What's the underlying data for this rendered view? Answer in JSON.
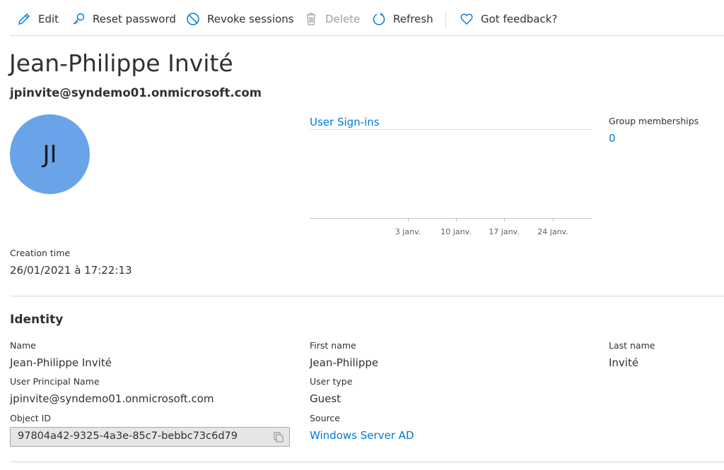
{
  "toolbar": {
    "edit": "Edit",
    "reset_password": "Reset password",
    "revoke_sessions": "Revoke sessions",
    "delete": "Delete",
    "refresh": "Refresh",
    "feedback": "Got feedback?"
  },
  "user": {
    "display_name": "Jean-Philippe Invité",
    "email": "jpinvite@syndemo01.onmicrosoft.com",
    "initials": "JI",
    "avatar_color": "#6aa4e8"
  },
  "creation": {
    "label": "Creation time",
    "value": "26/01/2021 à 17:22:13"
  },
  "chart_data": {
    "type": "line",
    "title": "User Sign-ins",
    "x_ticks": [
      "3 janv.",
      "10 janv.",
      "17 janv.",
      "24 janv."
    ],
    "series": []
  },
  "groups": {
    "label": "Group memberships",
    "value": "0"
  },
  "identity": {
    "heading": "Identity",
    "name_label": "Name",
    "name": "Jean-Philippe Invité",
    "first_name_label": "First name",
    "first_name": "Jean-Philippe",
    "last_name_label": "Last name",
    "last_name": "Invité",
    "upn_label": "User Principal Name",
    "upn": "jpinvite@syndemo01.onmicrosoft.com",
    "user_type_label": "User type",
    "user_type": "Guest",
    "object_id_label": "Object ID",
    "object_id": "97804a42-9325-4a3e-85c7-bebbc73c6d79",
    "source_label": "Source",
    "source": "Windows Server AD"
  }
}
